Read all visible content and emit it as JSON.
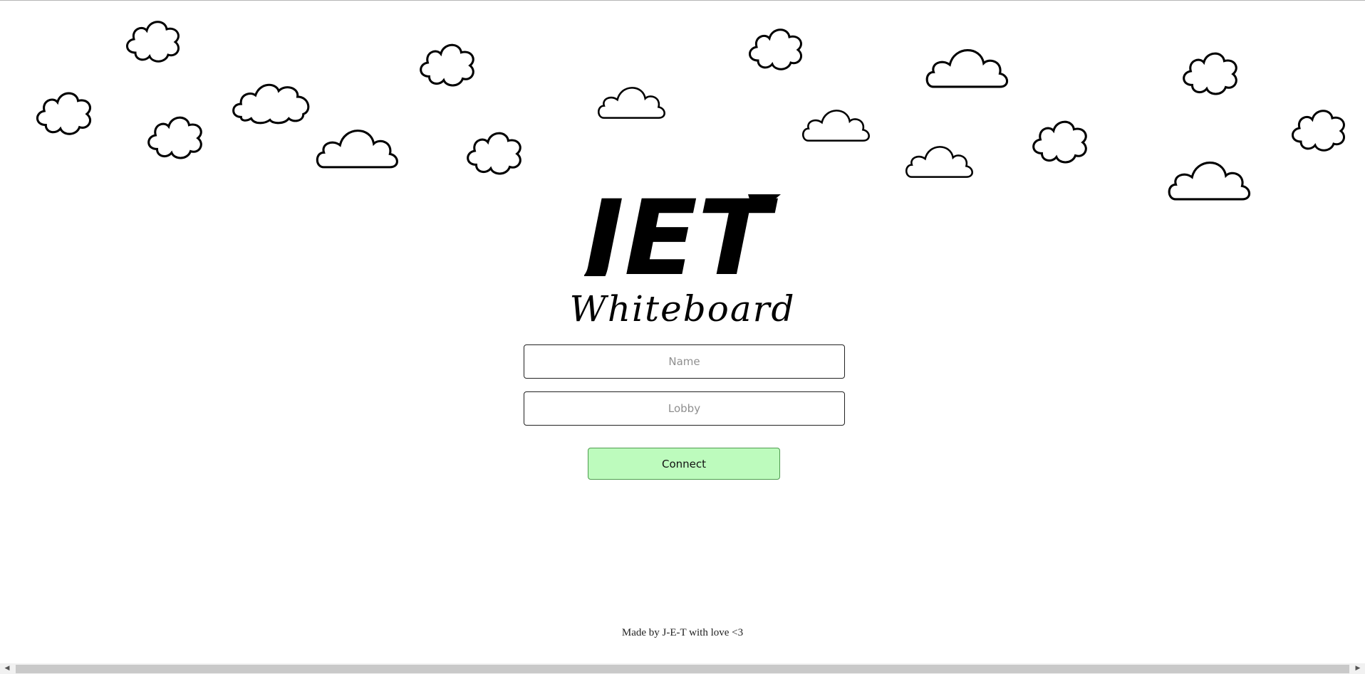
{
  "brand": {
    "logo_text": "JET",
    "subtitle": "Whiteboard"
  },
  "form": {
    "name_placeholder": "Name",
    "lobby_placeholder": "Lobby",
    "name_value": "",
    "lobby_value": "",
    "connect_label": "Connect"
  },
  "footer": {
    "text": "Made by J-E-T with love <3"
  },
  "icons": {
    "cloud": "cloud-icon",
    "scroll_left": "scroll-left-arrow-icon",
    "scroll_right": "scroll-right-arrow-icon"
  },
  "colors": {
    "background": "#ffffff",
    "connect_button": "#bdfbbd",
    "connect_border": "#4f9b4f",
    "text": "#000000"
  }
}
